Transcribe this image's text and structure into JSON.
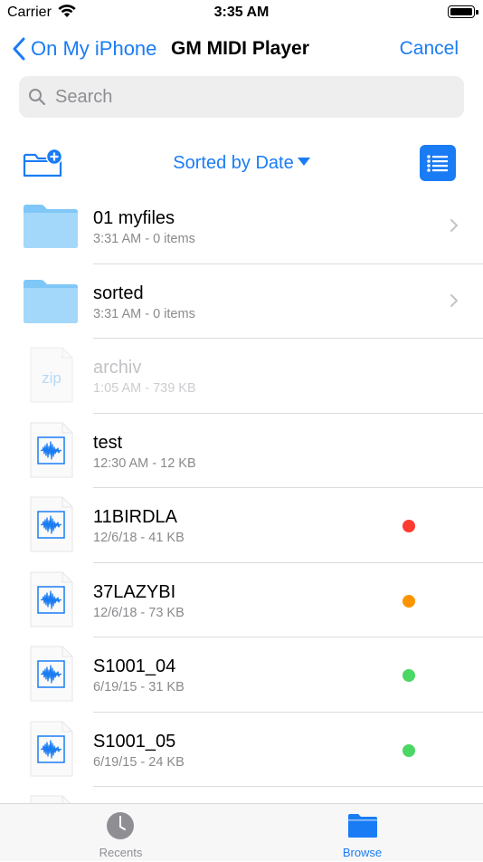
{
  "status_bar": {
    "carrier": "Carrier",
    "time": "3:35 AM"
  },
  "nav": {
    "back_label": "On My iPhone",
    "title": "GM MIDI Player",
    "cancel_label": "Cancel"
  },
  "search": {
    "placeholder": "Search"
  },
  "toolbar": {
    "sort_label": "Sorted by Date"
  },
  "colors": {
    "accent": "#1a7cf4",
    "folder": "#8fd0f8",
    "tag_red": "#fe3b30",
    "tag_orange": "#fe9500",
    "tag_green": "#4bd763"
  },
  "files": [
    {
      "name": "01 myfiles",
      "meta": "3:31 AM - 0 items",
      "kind": "folder-icon"
    },
    {
      "name": "sorted",
      "meta": "3:31 AM - 0 items",
      "kind": "folder-icon"
    },
    {
      "name": "archiv",
      "meta": "1:05 AM - 739 KB",
      "kind": "zip-file-icon",
      "thumb_text": "zip"
    },
    {
      "name": "test",
      "meta": "12:30 AM - 12 KB",
      "kind": "audio-file-icon"
    },
    {
      "name": "11BIRDLA",
      "meta": "12/6/18 - 41 KB",
      "kind": "audio-file-icon",
      "tag": "red"
    },
    {
      "name": "37LAZYBI",
      "meta": "12/6/18 - 73 KB",
      "kind": "audio-file-icon",
      "tag": "orange"
    },
    {
      "name": "S1001_04",
      "meta": "6/19/15 - 31 KB",
      "kind": "audio-file-icon",
      "tag": "green"
    },
    {
      "name": "S1001_05",
      "meta": "6/19/15 - 24 KB",
      "kind": "audio-file-icon",
      "tag": "green"
    }
  ],
  "tabs": [
    {
      "label": "Recents",
      "icon": "clock-icon",
      "selected": false
    },
    {
      "label": "Browse",
      "icon": "folder-icon",
      "selected": true
    }
  ]
}
